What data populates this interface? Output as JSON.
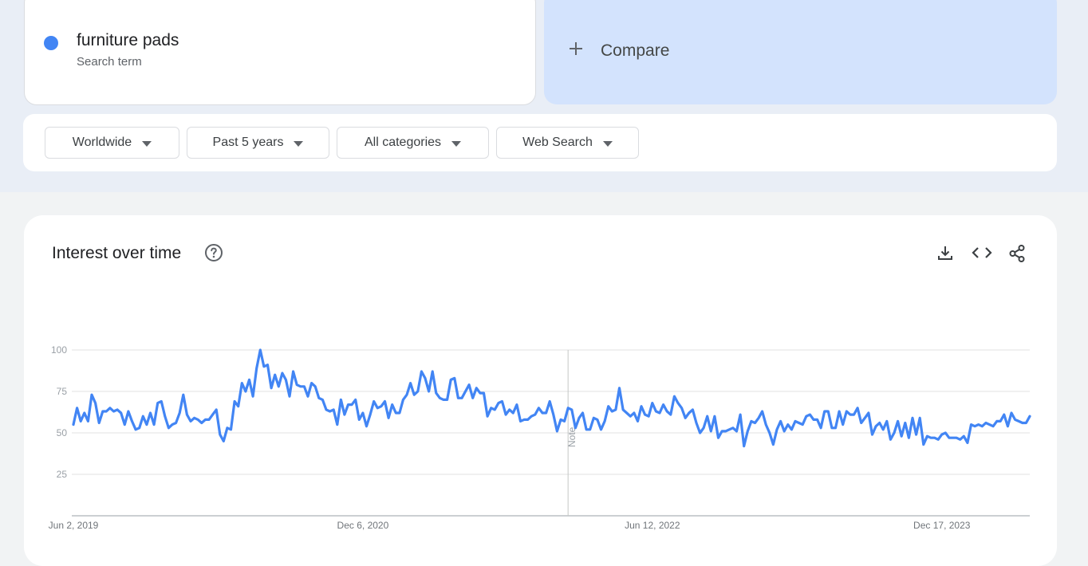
{
  "search_term": {
    "name": "furniture pads",
    "label": "Search term",
    "color": "#4285f4"
  },
  "compare": {
    "label": "Compare",
    "icon": "plus-icon"
  },
  "filters": [
    {
      "label": "Worldwide",
      "icon": "caret-down-icon"
    },
    {
      "label": "Past 5 years",
      "icon": "caret-down-icon"
    },
    {
      "label": "All categories",
      "icon": "caret-down-icon"
    },
    {
      "label": "Web Search",
      "icon": "caret-down-icon"
    }
  ],
  "interest_over_time": {
    "title": "Interest over time",
    "icons": [
      "help-icon",
      "download-icon",
      "embed-icon",
      "share-icon"
    ]
  },
  "chart_data": {
    "type": "line",
    "title": "",
    "xlabel": "",
    "ylabel": "",
    "ylim": [
      0,
      100
    ],
    "y_ticks": [
      "25",
      "50",
      "75",
      "100"
    ],
    "x_tick_labels": [
      "Jun 2, 2019",
      "Dec 6, 2020",
      "Jun 12, 2022",
      "Dec 17, 2023"
    ],
    "x_start": "2019-06-02",
    "x_step": "week",
    "x_tick_index": [
      0,
      79,
      158,
      237
    ],
    "annotation": {
      "label": "Note",
      "index": 135
    },
    "grid": true,
    "series": [
      {
        "color": "#4285f4",
        "values": [
          55,
          65,
          57,
          62,
          57,
          73,
          68,
          56,
          63,
          63,
          65,
          63,
          64,
          62,
          55,
          63,
          57,
          52,
          53,
          60,
          55,
          62,
          55,
          68,
          69,
          60,
          53,
          55,
          56,
          62,
          73,
          61,
          57,
          59,
          58,
          56,
          58,
          58,
          61,
          64,
          49,
          45,
          53,
          52,
          69,
          66,
          80,
          75,
          82,
          72,
          89,
          100,
          90,
          91,
          77,
          85,
          78,
          86,
          82,
          72,
          87,
          79,
          78,
          78,
          72,
          80,
          78,
          71,
          70,
          64,
          63,
          64,
          55,
          70,
          61,
          67,
          67,
          70,
          58,
          62,
          54,
          61,
          69,
          65,
          66,
          69,
          59,
          67,
          62,
          62,
          70,
          73,
          80,
          73,
          75,
          87,
          83,
          75,
          87,
          74,
          71,
          70,
          70,
          82,
          83,
          71,
          71,
          75,
          79,
          71,
          77,
          74,
          74,
          60,
          65,
          64,
          68,
          69,
          61,
          64,
          62,
          67,
          57,
          58,
          58,
          60,
          61,
          65,
          62,
          62,
          69,
          61,
          51,
          58,
          57,
          65,
          64,
          53,
          59,
          62,
          52,
          52,
          59,
          58,
          52,
          57,
          66,
          63,
          64,
          77,
          64,
          62,
          60,
          62,
          57,
          66,
          61,
          60,
          68,
          63,
          62,
          67,
          63,
          61,
          72,
          68,
          65,
          59,
          62,
          64,
          56,
          50,
          53,
          60,
          51,
          60,
          47,
          51,
          51,
          52,
          53,
          51,
          61,
          42,
          51,
          57,
          56,
          59,
          63,
          55,
          50,
          43,
          52,
          57,
          51,
          55,
          52,
          57,
          56,
          55,
          60,
          61,
          58,
          58,
          53,
          63,
          63,
          53,
          53,
          63,
          55,
          63,
          61,
          61,
          65,
          56,
          59,
          62,
          49,
          54,
          56,
          52,
          57,
          46,
          50,
          57,
          48,
          56,
          47,
          59,
          49,
          59,
          43,
          48,
          47,
          47,
          46,
          49,
          50,
          47,
          47,
          47,
          46,
          48,
          44,
          55,
          54,
          55,
          54,
          56,
          55,
          54,
          57,
          57,
          61,
          54,
          62,
          58,
          57,
          56,
          56,
          60
        ]
      }
    ]
  }
}
